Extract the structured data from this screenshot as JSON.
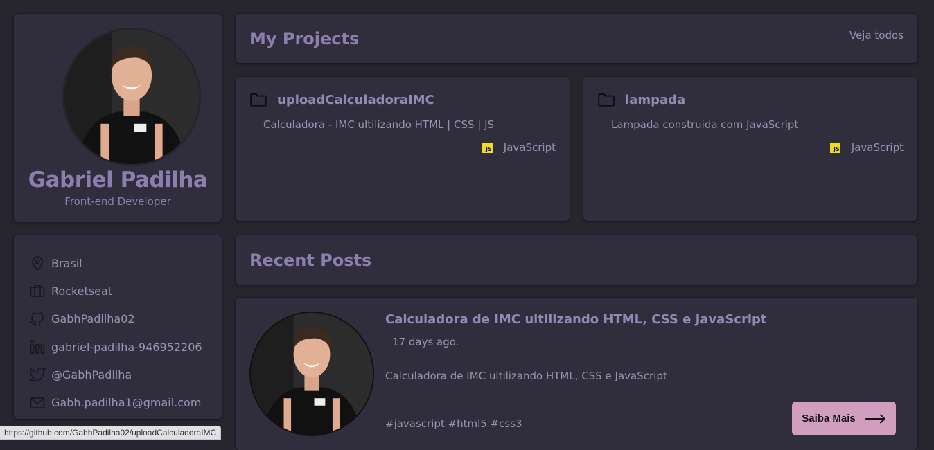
{
  "profile": {
    "name": "Gabriel Padilha",
    "role": "Front-end Developer"
  },
  "contacts": [
    {
      "icon": "location-pin-icon",
      "label": "Brasil"
    },
    {
      "icon": "briefcase-icon",
      "label": "Rocketseat"
    },
    {
      "icon": "github-icon",
      "label": "GabhPadilha02"
    },
    {
      "icon": "linkedin-icon",
      "label": "gabriel-padilha-946952206"
    },
    {
      "icon": "twitter-icon",
      "label": "@GabhPadilha"
    },
    {
      "icon": "mail-icon",
      "label": "Gabh.padilha1@gmail.com"
    }
  ],
  "projects_section": {
    "title": "My Projects",
    "see_all": "Veja todos"
  },
  "projects": [
    {
      "icon": "folder-icon",
      "name": "uploadCalculadoraIMC",
      "description": "Calculadora - IMC ultilizando HTML | CSS | JS",
      "language": "JavaScript",
      "language_badge": "JS"
    },
    {
      "icon": "folder-icon",
      "name": "lampada",
      "description": "Lampada construida com JavaScript",
      "language": "JavaScript",
      "language_badge": "JS"
    }
  ],
  "posts_section": {
    "title": "Recent Posts"
  },
  "post": {
    "title": "Calculadora de IMC ultilizando HTML, CSS e JavaScript",
    "date": "17 days ago.",
    "excerpt": "Calculadora de IMC ultilizando HTML, CSS e JavaScript",
    "tags": "#javascript #html5 #css3",
    "cta": "Saiba Mais"
  },
  "statusbar": {
    "url": "https://github.com/GabhPadilha02/uploadCalculadoraIMC"
  },
  "colors": {
    "background": "#27262f",
    "card": "#302e3c",
    "accent": "#8c7fae",
    "button": "#d29ec0",
    "js_badge": "#f0db1e"
  }
}
